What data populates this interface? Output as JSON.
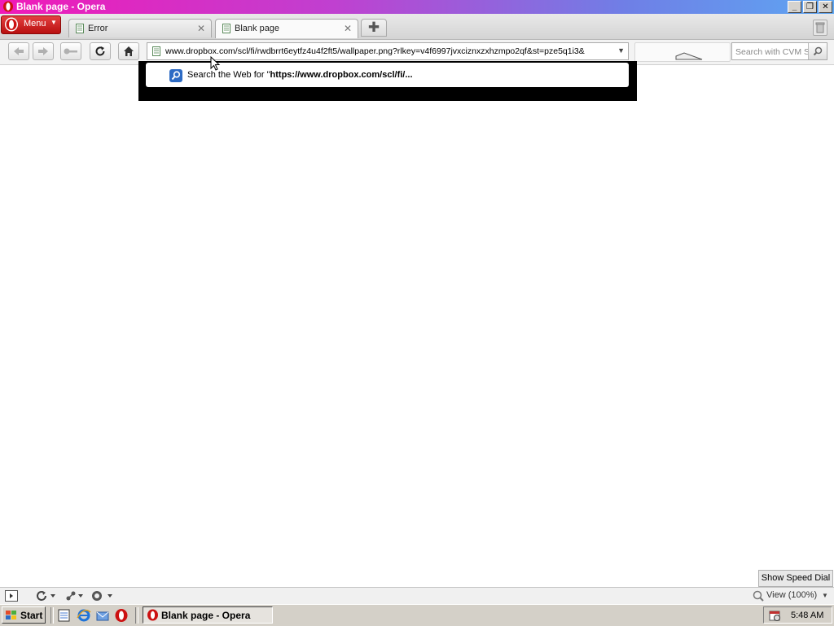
{
  "window": {
    "title": "Blank page - Opera"
  },
  "menu": {
    "label": "Menu"
  },
  "tabs": [
    {
      "label": "Error",
      "active": false
    },
    {
      "label": "Blank page",
      "active": true
    }
  ],
  "address": {
    "url": "www.dropbox.com/scl/fi/rwdbrrt6eytfz4u4f2ft5/wallpaper.png?rlkey=v4f6997jvxciznxzxhzmpo2qf&st=pze5q1i3&"
  },
  "search": {
    "placeholder": "Search with CVM S"
  },
  "dropdown": {
    "prefix": "Search the Web for \"",
    "query": "https://www.dropbox.com/scl/fi/..."
  },
  "speed_dial": {
    "label": "Show Speed Dial"
  },
  "statusbar": {
    "zoom": "View (100%)"
  },
  "taskbar": {
    "start": "Start",
    "task": "Blank page - Opera",
    "clock": "5:48 AM"
  },
  "colors": {
    "titlebar_start": "#f01ab8",
    "titlebar_end": "#5ea6f2",
    "opera_red": "#cc1111"
  }
}
